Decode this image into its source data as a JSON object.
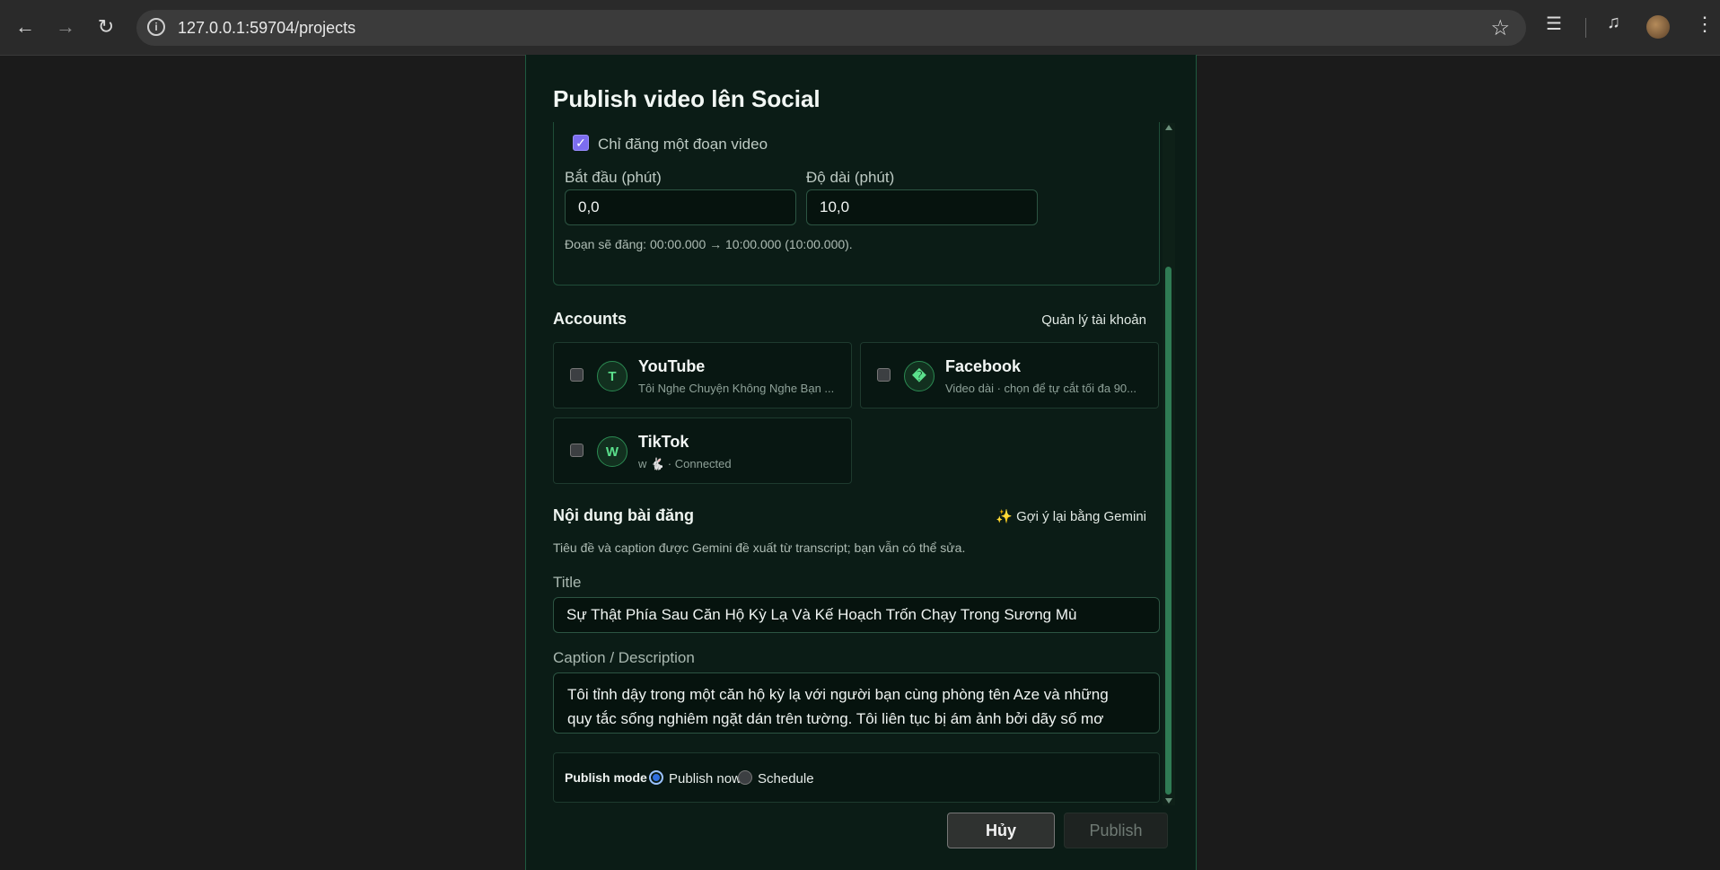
{
  "browser": {
    "url": "127.0.0.1:59704/projects"
  },
  "modal": {
    "title": "Publish video lên Social",
    "segment": {
      "checkbox_label": "Chỉ đăng một đoạn video",
      "checked": true,
      "start_label": "Bắt đầu (phút)",
      "start_value": "0,0",
      "length_label": "Độ dài (phút)",
      "length_value": "10,0",
      "hint": "Đoạn sẽ đăng: 00:00.000 → 10:00.000 (10:00.000)."
    },
    "accounts": {
      "title": "Accounts",
      "manage_link": "Quản lý tài khoản",
      "items": [
        {
          "name": "YouTube",
          "badge": "T",
          "subtitle": "Tôi Nghe Chuyện Không Nghe Bạn ...",
          "checked": false
        },
        {
          "name": "Facebook",
          "badge": "�",
          "subtitle": "Video dài · chọn để tự cắt tối đa 90...",
          "checked": false
        },
        {
          "name": "TikTok",
          "badge": "W",
          "subtitle": "w 🐇 · Connected",
          "checked": false
        }
      ]
    },
    "post": {
      "title": "Nội dung bài đăng",
      "gemini_link": "✨ Gợi ý lại bằng Gemini",
      "hint": "Tiêu đề và caption được Gemini đề xuất từ transcript; bạn vẫn có thể sửa.",
      "title_label": "Title",
      "title_value": "Sự Thật Phía Sau Căn Hộ Kỳ Lạ Và Kế Hoạch Trốn Chạy Trong Sương Mù",
      "caption_label": "Caption / Description",
      "caption_value": "Tôi tỉnh dậy trong một căn hộ kỳ lạ với người bạn cùng phòng tên Aze và những quy tắc sống nghiêm ngặt dán trên tường. Tôi liên tục bị ám ảnh bởi dãy số mơ hồ và những câu hỏi không có lời đáp."
    },
    "publish_mode": {
      "label": "Publish mode",
      "options": [
        {
          "label": "Publish now",
          "selected": true
        },
        {
          "label": "Schedule",
          "selected": false
        }
      ]
    },
    "buttons": {
      "cancel": "Hủy",
      "publish": "Publish"
    }
  }
}
